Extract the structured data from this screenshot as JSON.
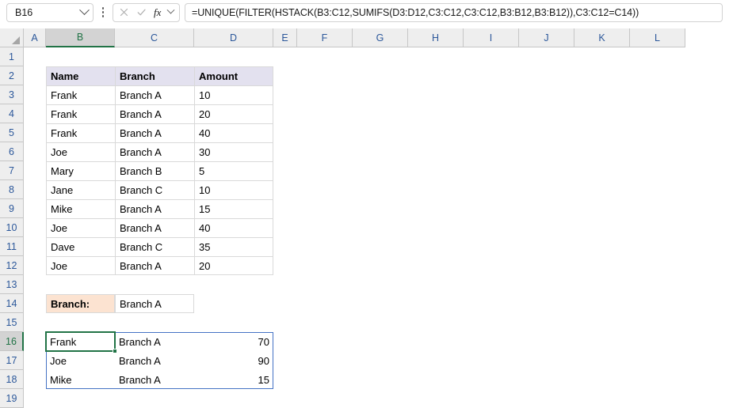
{
  "formula_bar": {
    "name_box_value": "B16",
    "formula": "=UNIQUE(FILTER(HSTACK(B3:C12,SUMIFS(D3:D12,C3:C12,C3:C12,B3:B12,B3:B12)),C3:C12=C14))",
    "cancel_icon": "cancel-icon",
    "enter_icon": "enter-icon",
    "function_icon": "insert-function-icon",
    "name_box_dropdown_icon": "chevron-down-icon",
    "options_icon": "more-options-icon"
  },
  "grid": {
    "column_headers": [
      "A",
      "B",
      "C",
      "D",
      "E",
      "F",
      "G",
      "H",
      "I",
      "J",
      "K",
      "L"
    ],
    "active_column": "B",
    "row_headers": [
      "1",
      "2",
      "3",
      "4",
      "5",
      "6",
      "7",
      "8",
      "9",
      "10",
      "11",
      "12",
      "13",
      "14",
      "15",
      "16",
      "17",
      "18",
      "19"
    ],
    "active_row": "16"
  },
  "source_table": {
    "range": "B2:D12",
    "headers": [
      "Name",
      "Branch",
      "Amount"
    ],
    "rows": [
      [
        "Frank",
        "Branch A",
        "10"
      ],
      [
        "Frank",
        "Branch A",
        "20"
      ],
      [
        "Frank",
        "Branch A",
        "40"
      ],
      [
        "Joe",
        "Branch A",
        "30"
      ],
      [
        "Mary",
        "Branch B",
        "5"
      ],
      [
        "Jane",
        "Branch C",
        "10"
      ],
      [
        "Mike",
        "Branch A",
        "15"
      ],
      [
        "Joe",
        "Branch A",
        "40"
      ],
      [
        "Dave",
        "Branch C",
        "35"
      ],
      [
        "Joe",
        "Branch A",
        "20"
      ]
    ]
  },
  "parameter": {
    "label": "Branch:",
    "value": "Branch A",
    "label_cell": "B14",
    "value_cell": "C14"
  },
  "result_spill": {
    "range": "B16:D18",
    "rows": [
      [
        "Frank",
        "Branch A",
        "70"
      ],
      [
        "Joe",
        "Branch A",
        "90"
      ],
      [
        "Mike",
        "Branch A",
        "15"
      ]
    ]
  },
  "colors": {
    "header_fill": "#E3E1EF",
    "parameter_fill": "#FCE3D1",
    "active_cell_border": "#217346",
    "spill_border": "#4472C4",
    "header_text": "#2B579A"
  }
}
